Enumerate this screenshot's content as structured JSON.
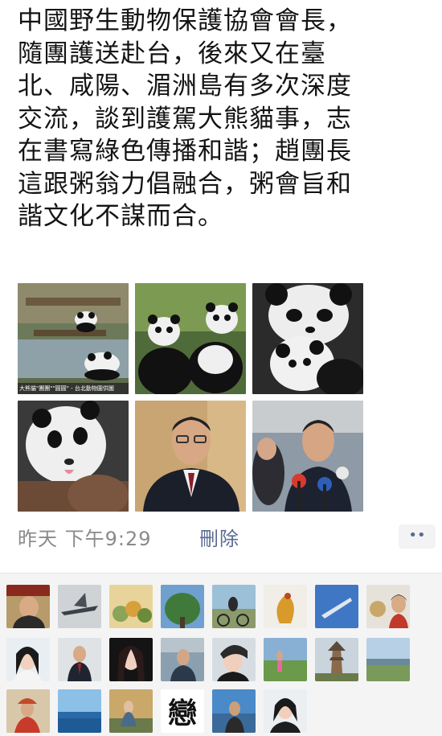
{
  "post": {
    "text": "中國野生動物保護協會會長，\n隨團護送赴台，後來又在臺\n北、咸陽、湄洲島有多次深度\n交流，談到護駕大熊貓事，志\n在書寫綠色傳播和諧；趙團長\n這跟粥翁力倡融合，粥會旨和\n諧文化不謀而合。"
  },
  "photos": [
    {
      "caption": "大熊貓\"團團\"\"圓圓\" - 台北動物園供圖"
    },
    {
      "caption": ""
    },
    {
      "caption": ""
    },
    {
      "caption": ""
    },
    {
      "caption": ""
    },
    {
      "caption": ""
    }
  ],
  "meta": {
    "time": "昨天 下午9:29",
    "delete_label": "刪除",
    "more_label": "••"
  },
  "likes": {
    "avatar_text_16": "戀"
  },
  "colors": {
    "link": "#5b6a92",
    "time": "#8a8a8a",
    "panel_bg": "#f4f4f4"
  }
}
